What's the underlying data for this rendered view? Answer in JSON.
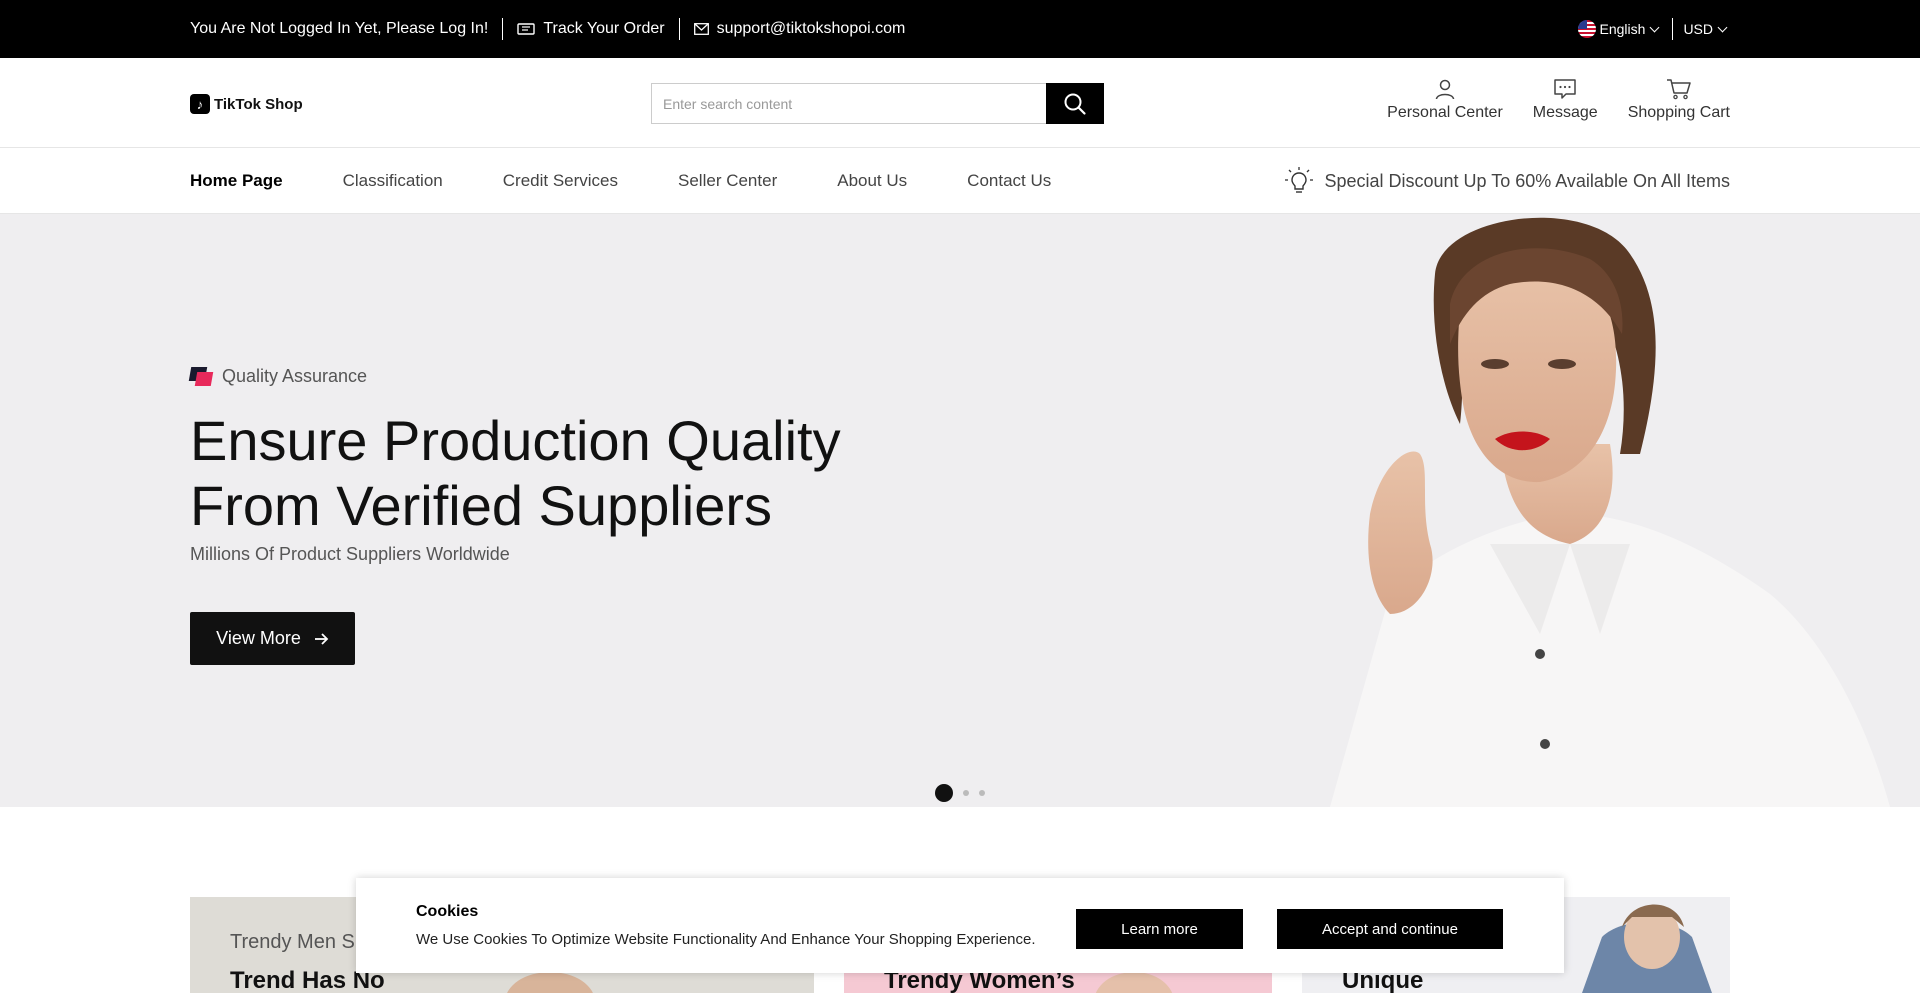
{
  "topbar": {
    "login_notice": "You Are Not Logged In Yet, Please Log In!",
    "track_order": "Track Your Order",
    "email": "support@tiktokshopoi.com",
    "language": "English",
    "currency": "USD"
  },
  "header": {
    "logo_text": "TikTok Shop",
    "search_placeholder": "Enter search content",
    "personal_center": "Personal Center",
    "message": "Message",
    "shopping_cart": "Shopping Cart"
  },
  "nav": {
    "items": [
      "Home Page",
      "Classification",
      "Credit Services",
      "Seller Center",
      "About Us",
      "Contact Us"
    ],
    "active_index": 0,
    "promo": "Special Discount Up To 60% Available On All Items"
  },
  "hero": {
    "tag": "Quality Assurance",
    "title": "Ensure Production Quality From Verified Suppliers",
    "subtitle": "Millions Of Product Suppliers Worldwide",
    "button": "View More",
    "slide_count": 3,
    "active_slide": 0
  },
  "cards": [
    {
      "small": "Trendy Men S",
      "big": "Trend Has No"
    },
    {
      "small": "",
      "big": "Trendy Women’s"
    },
    {
      "small": "",
      "big": "Unique"
    }
  ],
  "cookie": {
    "title": "Cookies",
    "text": "We Use Cookies To Optimize Website Functionality And Enhance Your Shopping Experience.",
    "learn_more": "Learn more",
    "accept": "Accept and continue"
  },
  "colors": {
    "topbar_bg": "#000000",
    "hero_bg": "#efeef0",
    "accent_pink": "#e8295b"
  }
}
